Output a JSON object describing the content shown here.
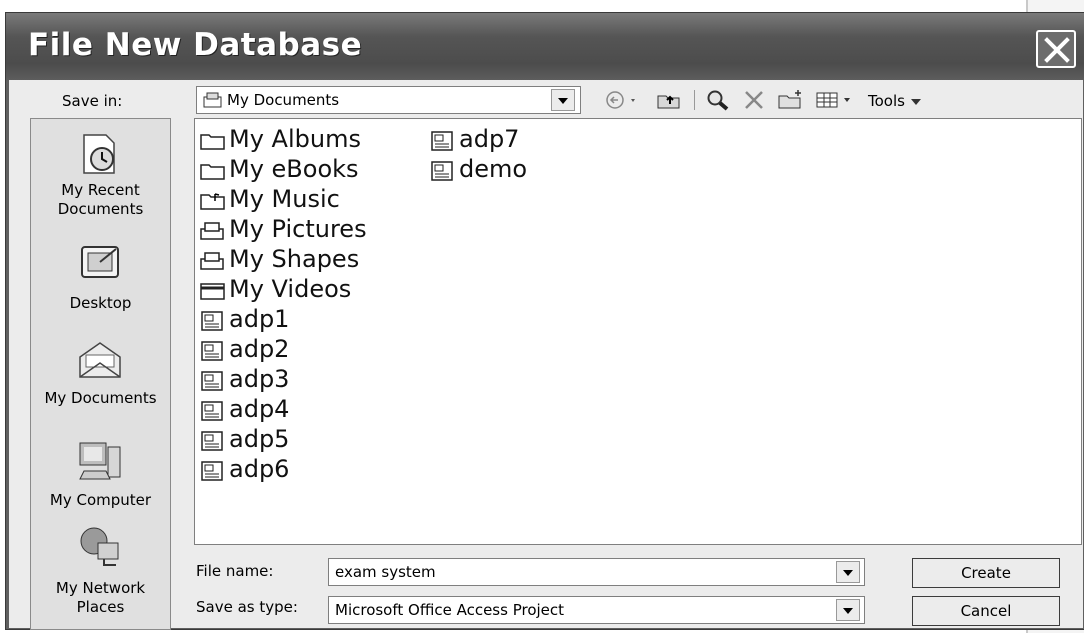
{
  "window": {
    "title": "File New Database"
  },
  "toolbar": {
    "save_in_label": "Save in:",
    "save_in_value": "My Documents",
    "tools_label": "Tools",
    "icons": [
      "back-icon",
      "up-folder-icon",
      "search-web-icon",
      "delete-icon",
      "new-folder-icon",
      "views-icon"
    ]
  },
  "places": [
    {
      "label": "My Recent Documents",
      "icon": "recent-documents-icon"
    },
    {
      "label": "Desktop",
      "icon": "desktop-icon"
    },
    {
      "label": "My Documents",
      "icon": "my-documents-icon"
    },
    {
      "label": "My Computer",
      "icon": "my-computer-icon"
    },
    {
      "label": "My Network Places",
      "icon": "network-places-icon"
    }
  ],
  "files": [
    {
      "name": "My Albums",
      "type": "folder"
    },
    {
      "name": "My eBooks",
      "type": "folder"
    },
    {
      "name": "My Music",
      "type": "music-folder"
    },
    {
      "name": "My Pictures",
      "type": "pictures-folder"
    },
    {
      "name": "My Shapes",
      "type": "pictures-folder"
    },
    {
      "name": "My Videos",
      "type": "video-folder"
    },
    {
      "name": "adp1",
      "type": "access-project"
    },
    {
      "name": "adp2",
      "type": "access-project"
    },
    {
      "name": "adp3",
      "type": "access-project"
    },
    {
      "name": "adp4",
      "type": "access-project"
    },
    {
      "name": "adp5",
      "type": "access-project"
    },
    {
      "name": "adp6",
      "type": "access-project"
    },
    {
      "name": "adp7",
      "type": "access-project"
    },
    {
      "name": "demo",
      "type": "access-project"
    }
  ],
  "form": {
    "file_name_label": "File name:",
    "file_name_value": "exam system",
    "save_as_type_label": "Save as type:",
    "save_as_type_value": "Microsoft Office Access Project"
  },
  "buttons": {
    "create": "Create",
    "cancel": "Cancel"
  },
  "colors": {
    "titlebar": "#555555",
    "dialog_bg": "#ececec",
    "places_bg": "#e0e0e0"
  }
}
